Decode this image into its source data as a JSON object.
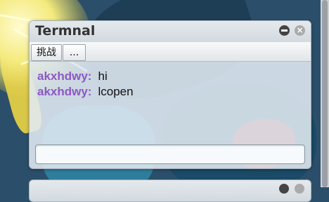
{
  "window": {
    "title": "Termnal",
    "minimize_icon": "minus-circle-icon",
    "close_icon": "close-circle-icon",
    "close_glyph": "×"
  },
  "tabs": [
    {
      "label": "挑战"
    },
    {
      "label": "..."
    }
  ],
  "messages": [
    {
      "user": "akxhdwy:",
      "text": "hi"
    },
    {
      "user": "akxhdwy:",
      "text": "lcopen"
    }
  ],
  "input": {
    "value": "",
    "placeholder": ""
  },
  "colors": {
    "username": "#8e57c6",
    "panel": "#e1ebf2",
    "titlebar": "#d3dadf"
  }
}
